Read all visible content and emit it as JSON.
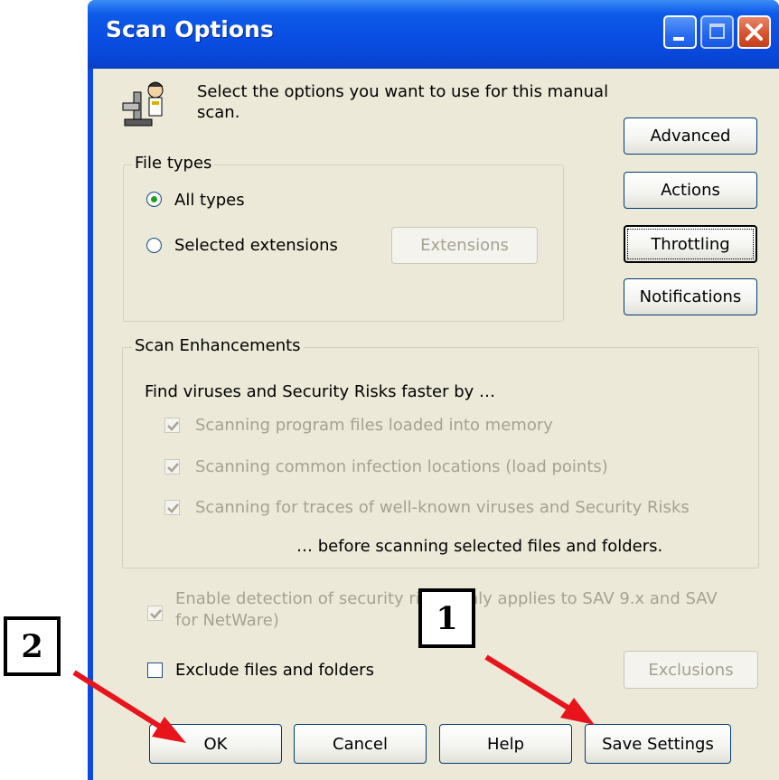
{
  "window": {
    "title": "Scan Options",
    "controls": {
      "minimize": "minimize-icon",
      "maximize": "maximize-icon",
      "close": "close-icon"
    }
  },
  "intro": {
    "line1": "Select the options you want to use for this manual",
    "line2": "scan."
  },
  "file_types": {
    "legend": "File types",
    "all_types": "All types",
    "selected_extensions": "Selected extensions",
    "extensions_button": "Extensions",
    "selected": "all_types"
  },
  "side_buttons": {
    "advanced": "Advanced",
    "actions": "Actions",
    "throttling": "Throttling",
    "notifications": "Notifications"
  },
  "scan_enhancements": {
    "legend": "Scan Enhancements",
    "intro": "Find viruses and Security Risks faster by …",
    "options": [
      {
        "label": "Scanning program files loaded into memory",
        "checked": true,
        "enabled": false
      },
      {
        "label": "Scanning common infection locations (load points)",
        "checked": true,
        "enabled": false
      },
      {
        "label": "Scanning for traces of well-known viruses and Security Risks",
        "checked": true,
        "enabled": false
      }
    ],
    "footer": "… before scanning selected files and folders."
  },
  "security_risks": {
    "line1": "Enable detection of security risks (only applies to SAV 9.x and SAV",
    "line2": "for NetWare)",
    "checked": true,
    "enabled": false
  },
  "exclude": {
    "label": "Exclude files and folders",
    "checked": false,
    "exclusions_button": "Exclusions"
  },
  "bottom_buttons": {
    "ok": "OK",
    "cancel": "Cancel",
    "help": "Help",
    "save": "Save Settings"
  },
  "annotations": {
    "callout_1": "1",
    "callout_2": "2",
    "arrow_color": "#e8141c"
  }
}
